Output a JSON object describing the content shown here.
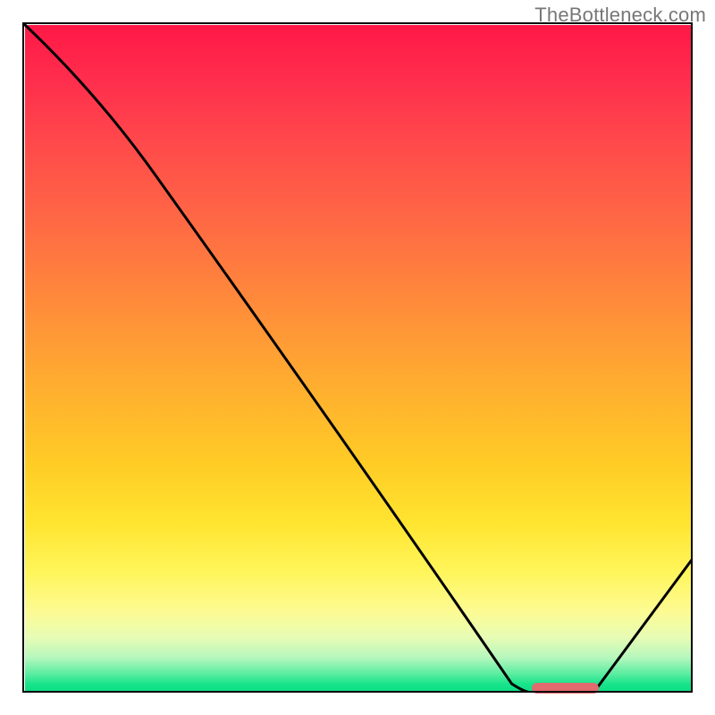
{
  "attribution": "TheBottleneck.com",
  "chart_data": {
    "type": "line",
    "title": "",
    "xlabel": "",
    "ylabel": "",
    "xlim": [
      0,
      100
    ],
    "ylim": [
      0,
      100
    ],
    "series": [
      {
        "name": "bottleneck-curve",
        "x": [
          0,
          20,
          75,
          85,
          100
        ],
        "values": [
          100,
          77,
          0,
          0,
          20
        ]
      }
    ],
    "marker": {
      "name": "optimal-range",
      "x_start": 76,
      "x_end": 86,
      "y": 0.7,
      "color": "#e16b6f"
    },
    "background_gradient": {
      "top": "#ff1846",
      "mid": "#ffe531",
      "bottom": "#0fde86"
    }
  }
}
